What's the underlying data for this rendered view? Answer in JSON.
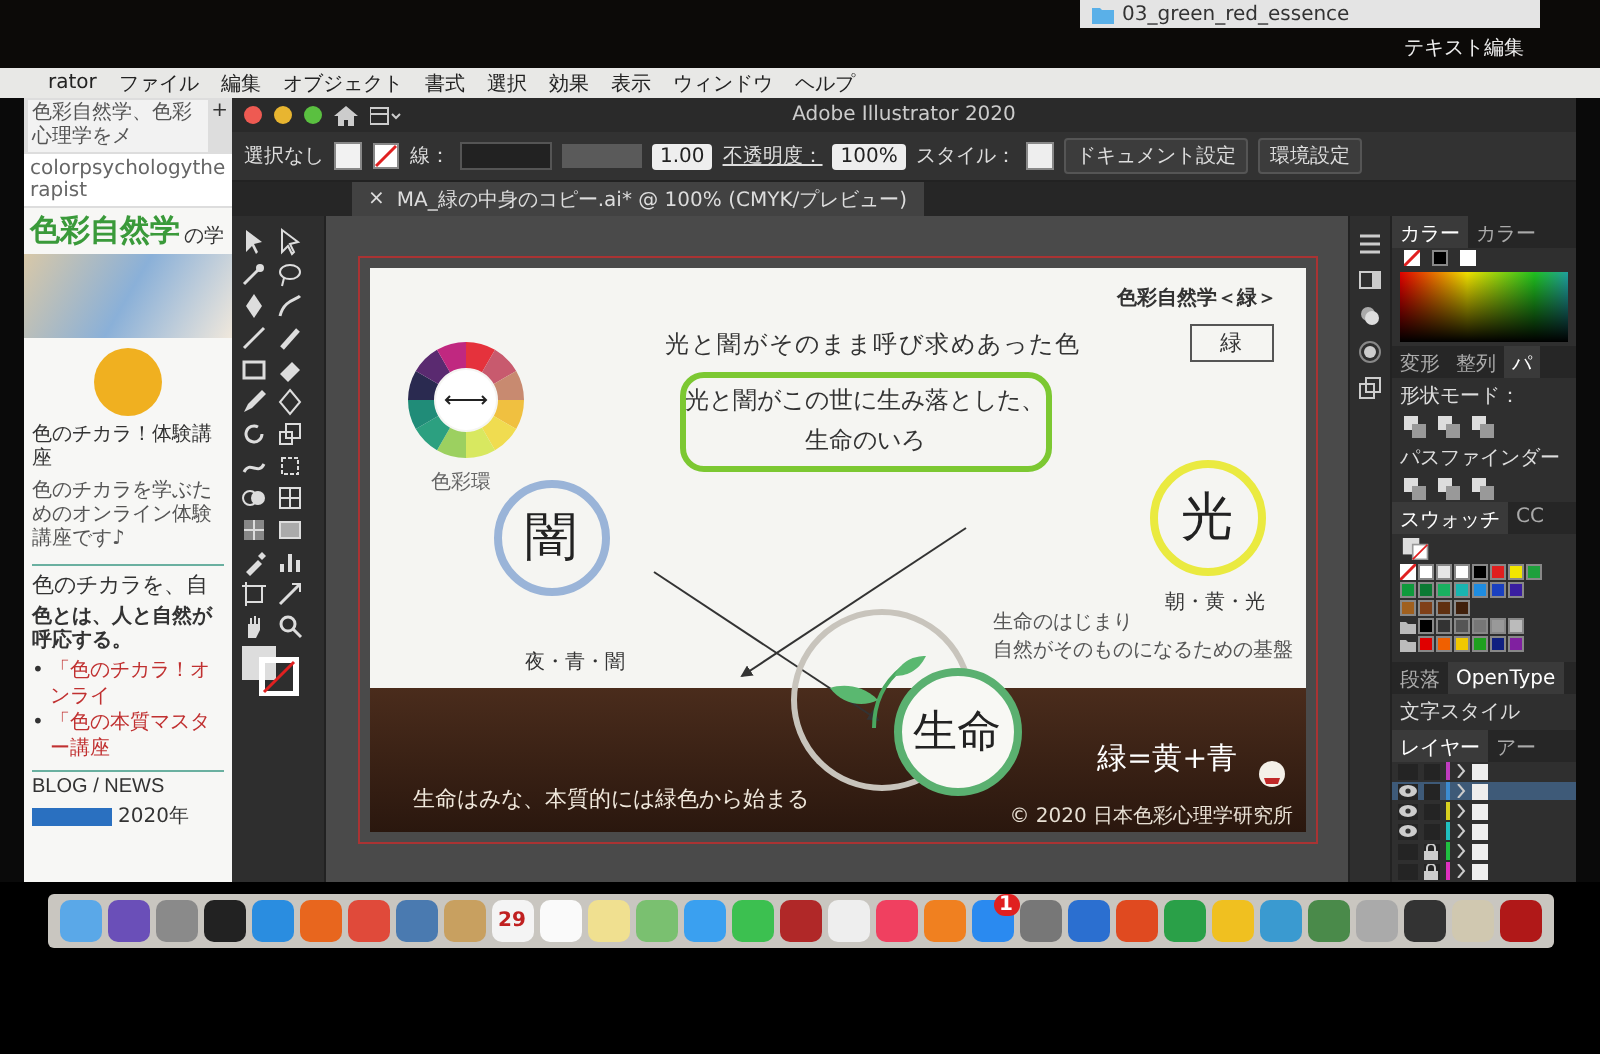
{
  "top_strip": {
    "folder": "03_green_red_essence",
    "app_menu": "テキスト編集"
  },
  "menu_bar": [
    "rator",
    "ファイル",
    "編集",
    "オブジェクト",
    "書式",
    "選択",
    "効果",
    "表示",
    "ウィンドウ",
    "ヘルプ"
  ],
  "browser": {
    "tab_title": "色彩自然学、色彩心理学をメ",
    "new_tab": "+",
    "url": "colorpsychologytherapist",
    "logo": "色彩自然学",
    "logo_sub": "の学",
    "card_title": "色のチカラ！体験講座",
    "card_text": "色のチカラを学ぶためのオンライン体験講座です♪",
    "heading": "色のチカラを、自",
    "intro": "色とは、人と自然が呼応する。",
    "links": [
      {
        "bullet": "•",
        "text": "「色のチカラ！オンライ"
      },
      {
        "bullet": "•",
        "text": "「色の本質マスター講座"
      }
    ],
    "section": "BLOG / NEWS",
    "date": "2020年"
  },
  "illustrator": {
    "title": "Adobe Illustrator 2020",
    "control_bar": {
      "selection": "選択なし",
      "stroke_label": "線：",
      "brush": "1.00",
      "opacity_label": "不透明度：",
      "opacity": "100%",
      "style_label": "スタイル：",
      "buttons": [
        "ドキュメント設定",
        "環境設定"
      ]
    },
    "document_tab": {
      "close": "×",
      "title": "MA_緑の中身のコピー.ai* @ 100% (CMYK/プレビュー)"
    },
    "artboard": {
      "series": "色彩自然学＜緑＞",
      "color_name": "緑",
      "wheel_label": "色彩環",
      "lead": "光と闇がそのまま呼び求めあった色",
      "callout": [
        "光と闇がこの世に生み落とした、",
        "生命のいろ"
      ],
      "dark": "闇",
      "dark_words": "夜・青・闇",
      "light": "光",
      "light_words": "朝・黄・光",
      "note": [
        "生命のはじまり",
        "自然がそのものになるための基盤"
      ],
      "life": "生命",
      "formula": "緑=黄+青",
      "footer": "生命はみな、本質的には緑色から始まる",
      "copyright": "© 2020 日本色彩心理学研究所"
    },
    "panels": {
      "color_tabs": [
        {
          "label": "カラー",
          "selected": true
        },
        {
          "label": "カラー",
          "selected": false
        }
      ],
      "transform_tabs": [
        {
          "label": "変形",
          "selected": false
        },
        {
          "label": "整列",
          "selected": false
        },
        {
          "label": "パ",
          "selected": true
        }
      ],
      "shape_mode": "形状モード：",
      "pathfinder": "パスファインダー",
      "swatch_tabs": [
        {
          "label": "スウォッチ",
          "selected": true
        },
        {
          "label": "CC",
          "selected": false
        }
      ],
      "swatch_rows": [
        {
          "kind": "plain",
          "swatches": [
            {
              "color": "#ffffff"
            },
            {
              "color": "#e6e6e6"
            },
            {
              "color": "#ffffff"
            },
            {
              "color": "#000000"
            },
            {
              "color": "#e01e1e"
            },
            {
              "color": "#f2e600"
            },
            {
              "color": "#1ea03c"
            }
          ]
        },
        {
          "kind": "plain",
          "swatches": [
            {
              "color": "#0f9a3c"
            },
            {
              "color": "#0c7a34"
            },
            {
              "color": "#18b060"
            },
            {
              "color": "#18b4b0"
            },
            {
              "color": "#1e8ce0"
            },
            {
              "color": "#1a40c0"
            },
            {
              "color": "#3a1ea0"
            }
          ]
        },
        {
          "kind": "plain",
          "swatches": [
            {
              "color": "#a0601e"
            },
            {
              "color": "#804018"
            },
            {
              "color": "#603010"
            },
            {
              "color": "#40200c"
            }
          ]
        },
        {
          "kind": "group",
          "swatches": [
            {
              "color": "#000000"
            },
            {
              "color": "#333333"
            },
            {
              "color": "#555555"
            },
            {
              "color": "#777777"
            },
            {
              "color": "#999999"
            },
            {
              "color": "#bbbbbb"
            }
          ]
        },
        {
          "kind": "group",
          "swatches": [
            {
              "color": "#e00000"
            },
            {
              "color": "#f06000"
            },
            {
              "color": "#f0c800"
            },
            {
              "color": "#1ea01e"
            },
            {
              "color": "#102080"
            },
            {
              "color": "#8020a0"
            }
          ]
        }
      ],
      "type_tabs": [
        {
          "label": "段落",
          "selected": false
        },
        {
          "label": "OpenType",
          "selected": true
        }
      ],
      "char_style": "文字スタイル",
      "layer_tabs": [
        {
          "label": "レイヤー",
          "selected": true
        },
        {
          "label": "アー",
          "selected": false
        }
      ],
      "layers": [
        {
          "color": "#c03cc0",
          "visible": false,
          "locked": false,
          "selected": false
        },
        {
          "color": "#3c8cd0",
          "visible": true,
          "locked": false,
          "selected": true
        },
        {
          "color": "#d8d020",
          "visible": true,
          "locked": false,
          "selected": false
        },
        {
          "color": "#20c0c0",
          "visible": true,
          "locked": false,
          "selected": false
        },
        {
          "color": "#20c040",
          "visible": false,
          "locked": true,
          "selected": false
        },
        {
          "color": "#e030c0",
          "visible": false,
          "locked": true,
          "selected": false
        }
      ]
    }
  },
  "dock": [
    {
      "color": "#5aa8e8"
    },
    {
      "color": "#6a4fb8"
    },
    {
      "color": "#8a8a8a"
    },
    {
      "color": "#222222"
    },
    {
      "color": "#2a8de0"
    },
    {
      "color": "#e8661e"
    },
    {
      "color": "#e04a3a"
    },
    {
      "color": "#4a7ab0"
    },
    {
      "color": "#c8a060"
    },
    {
      "color": "#f4f4f4",
      "label": "29"
    },
    {
      "color": "#fafafa"
    },
    {
      "color": "#f0e090"
    },
    {
      "color": "#7ac070"
    },
    {
      "color": "#3aa0f0"
    },
    {
      "color": "#3cc050"
    },
    {
      "color": "#b02828"
    },
    {
      "color": "#eeeeee"
    },
    {
      "color": "#f04060"
    },
    {
      "color": "#f08020"
    },
    {
      "color": "#2a8af0",
      "badge": "1"
    },
    {
      "color": "#777777"
    },
    {
      "color": "#2b6fd0"
    },
    {
      "color": "#e04a20"
    },
    {
      "color": "#2aa048"
    },
    {
      "color": "#f0c020"
    },
    {
      "color": "#3a9ad0"
    },
    {
      "color": "#4a8a4a"
    },
    {
      "color": "#aaaaaa"
    },
    {
      "color": "#333333"
    },
    {
      "color": "#d0c8b0"
    },
    {
      "color": "#b01818"
    }
  ]
}
